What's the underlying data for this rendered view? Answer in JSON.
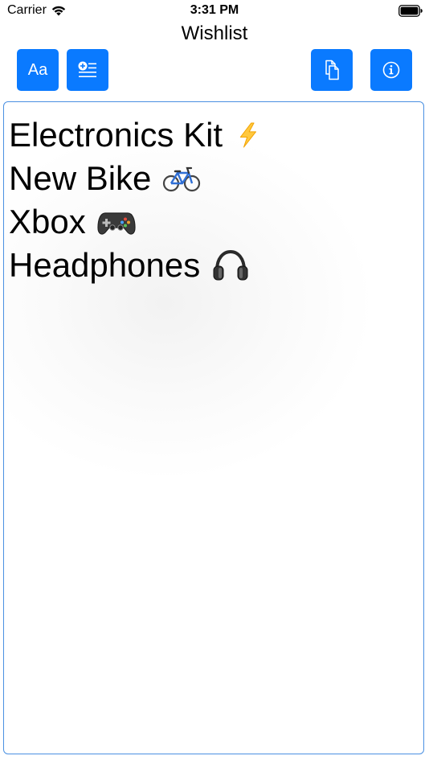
{
  "status_bar": {
    "carrier": "Carrier",
    "time": "3:31 PM"
  },
  "title": "Wishlist",
  "toolbar": {
    "font_button_label": "Aa",
    "icons": [
      "font-size-icon",
      "add-list-icon",
      "copy-document-icon",
      "info-icon"
    ]
  },
  "colors": {
    "accent": "#0a7aff",
    "editor_border": "#4a90e2"
  },
  "wishlist": {
    "items": [
      {
        "text": "Electronics Kit",
        "emoji": "lightning-icon"
      },
      {
        "text": "New Bike",
        "emoji": "bicycle-icon"
      },
      {
        "text": "Xbox",
        "emoji": "game-controller-icon"
      },
      {
        "text": "Headphones",
        "emoji": "headphones-icon"
      }
    ]
  }
}
